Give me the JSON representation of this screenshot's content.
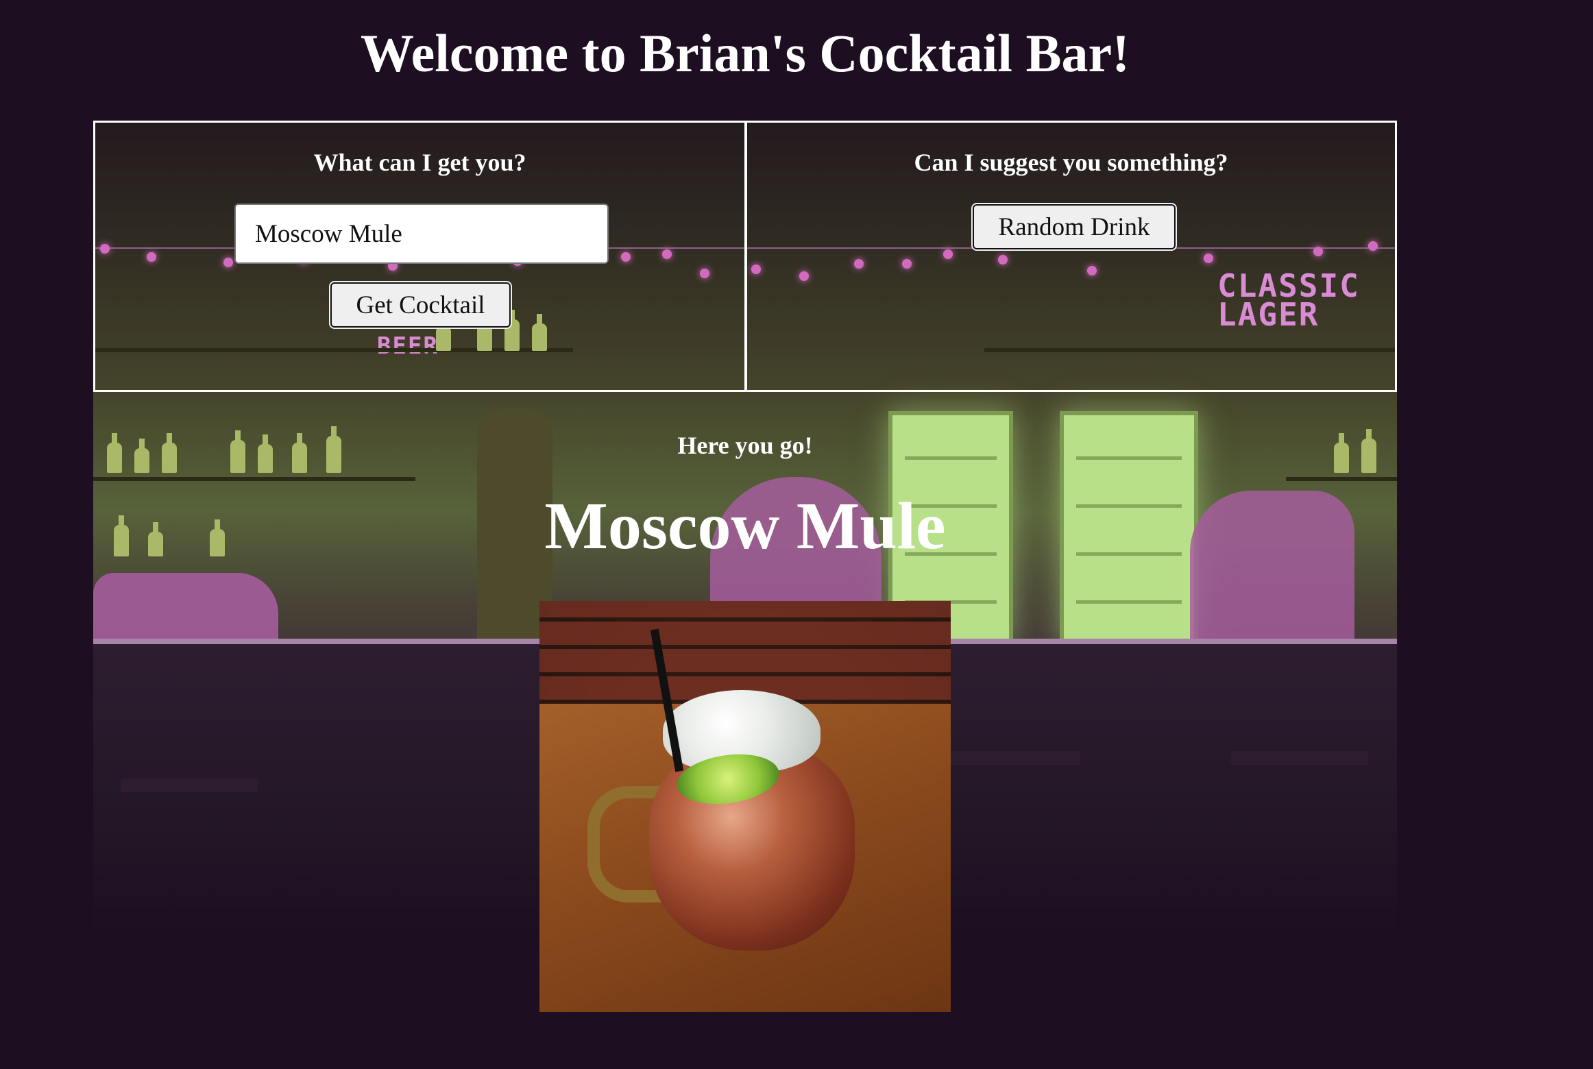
{
  "page": {
    "title": "Welcome to Brian's Cocktail Bar!",
    "background_color": "#1d0f21"
  },
  "search_panel": {
    "heading": "What can I get you?",
    "input_value": "Moscow Mule",
    "button_label": "Get Cocktail"
  },
  "suggest_panel": {
    "heading": "Can I suggest you something?",
    "button_label": "Random Drink"
  },
  "result": {
    "label": "Here you go!",
    "drink_name": "Moscow Mule",
    "image_subject": "Moscow Mule in copper mug with crushed ice, lime wedge and black straw"
  },
  "background_signs": {
    "left_sign": "BEER",
    "right_sign": "CLASSIC LAGER"
  },
  "colors": {
    "neon_pink": "#d26bbf",
    "bottle_green": "#a9b968",
    "fridge_glow": "#b7e089",
    "panel_border": "#ffffff",
    "button_bg": "#efefef"
  }
}
